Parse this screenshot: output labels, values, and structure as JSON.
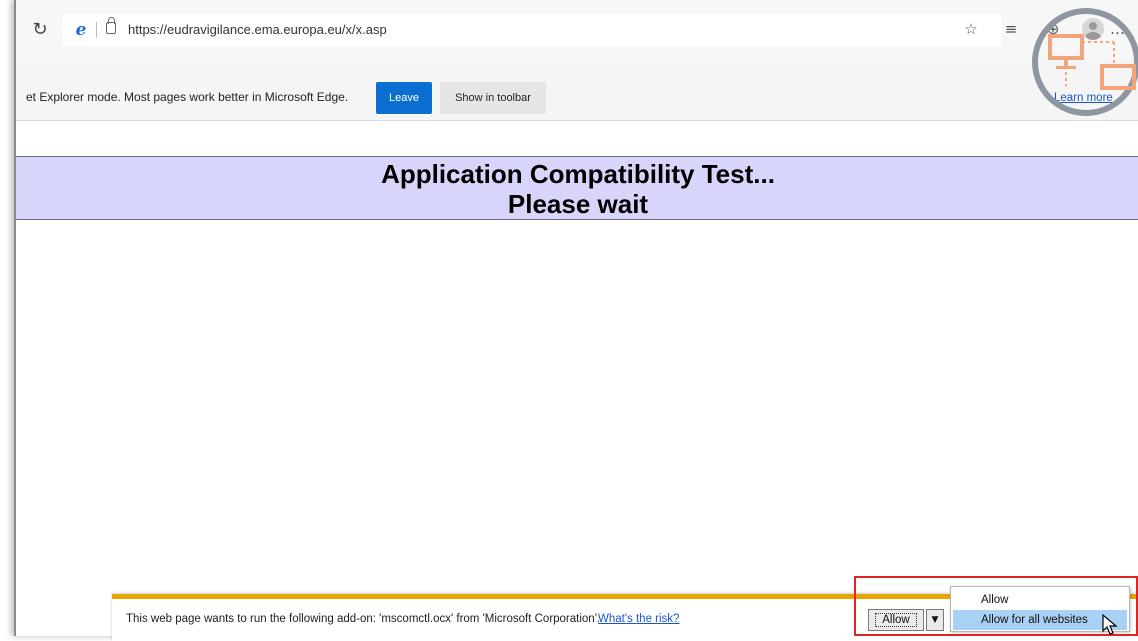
{
  "address_bar": {
    "url": "https://eudravigilance.ema.europa.eu/x/x.asp"
  },
  "toolbar": {
    "icons": [
      "refresh-icon",
      "ie-logo-icon",
      "lock-icon",
      "favorite-add-icon",
      "favorites-icon",
      "collections-icon",
      "profile-avatar-icon",
      "more-icon"
    ]
  },
  "infobar": {
    "message": "et Explorer mode. Most pages work better in Microsoft Edge.",
    "leave_label": "Leave",
    "show_toolbar_label": "Show in toolbar",
    "learn_more_label": "Learn more"
  },
  "page": {
    "title": "Application Compatibility Test...",
    "subtitle": "Please wait",
    "banner_color": "#d8d5fb"
  },
  "notification": {
    "message": "This web page wants to run the following add-on: 'mscomctl.ocx' from 'Microsoft Corporation'.",
    "risk_link": "What's the risk?",
    "allow_label": "Allow",
    "accent_color": "#e8a500"
  },
  "allow_menu": {
    "items": [
      {
        "label": "Allow",
        "selected": false
      },
      {
        "label": "Allow for all websites",
        "selected": true
      }
    ]
  },
  "highlight_color": "#e02424"
}
